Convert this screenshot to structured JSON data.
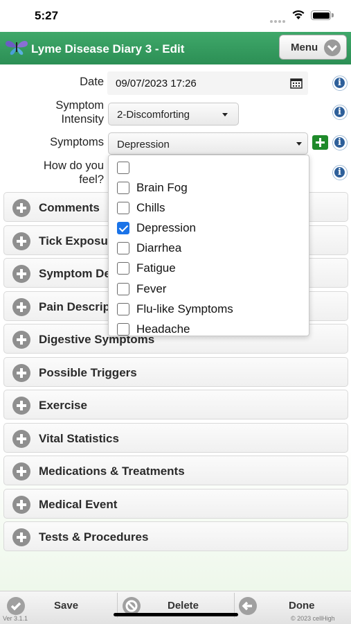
{
  "status_bar": {
    "time": "5:27"
  },
  "header": {
    "title": "Lyme Disease Diary 3 - Edit",
    "menu_label": "Menu"
  },
  "form": {
    "date": {
      "label": "Date",
      "value": "09/07/2023 17:26"
    },
    "intensity": {
      "label_line1": "Symptom",
      "label_line2": "Intensity",
      "value": "2-Discomforting"
    },
    "symptoms": {
      "label": "Symptoms",
      "value": "Depression"
    },
    "feel": {
      "label_line1": "How do you",
      "label_line2": "feel?"
    }
  },
  "symptoms_dropdown": {
    "options": [
      {
        "label": "",
        "checked": false
      },
      {
        "label": "Brain Fog",
        "checked": false
      },
      {
        "label": "Chills",
        "checked": false
      },
      {
        "label": "Depression",
        "checked": true
      },
      {
        "label": "Diarrhea",
        "checked": false
      },
      {
        "label": "Fatigue",
        "checked": false
      },
      {
        "label": "Fever",
        "checked": false
      },
      {
        "label": "Flu-like Symptoms",
        "checked": false
      },
      {
        "label": "Headache",
        "checked": false
      }
    ]
  },
  "sections": [
    {
      "label": "Comments"
    },
    {
      "label": "Tick Exposure"
    },
    {
      "label": "Symptom Details"
    },
    {
      "label": "Pain Description"
    },
    {
      "label": "Digestive Symptoms"
    },
    {
      "label": "Possible Triggers"
    },
    {
      "label": "Exercise"
    },
    {
      "label": "Vital Statistics"
    },
    {
      "label": "Medications & Treatments"
    },
    {
      "label": "Medical Event"
    },
    {
      "label": "Tests & Procedures"
    }
  ],
  "footer": {
    "save_label": "Save",
    "delete_label": "Delete",
    "done_label": "Done",
    "version": "Ver 3.1.1",
    "copyright": "© 2023 cellHigh"
  },
  "colors": {
    "header_green": "#2f9a5c",
    "checkbox_blue": "#1a73e8",
    "add_green": "#1e8a2a",
    "info_blue": "#2d5f9a"
  }
}
